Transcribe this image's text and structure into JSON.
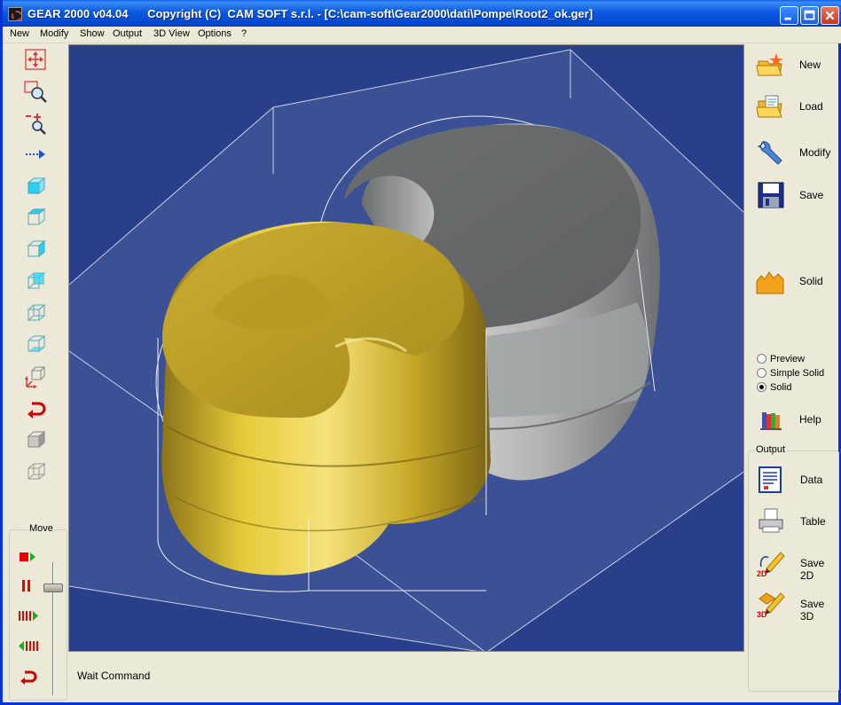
{
  "window": {
    "title": "GEAR 2000 v04.04      Copyright (C)  CAM SOFT s.r.l. - [C:\\cam-soft\\Gear2000\\dati\\Pompe\\Root2_ok.ger]"
  },
  "menu": [
    "New",
    "Modify",
    "Show",
    "Output",
    "3D View",
    "Options",
    "?"
  ],
  "left_tools": [
    "move-view-icon",
    "zoom-window-icon",
    "zoom-in-out-icon",
    "pan-arrow-icon",
    "view-front-cube-icon",
    "view-top-cube-icon",
    "view-side-cube-icon",
    "view-iso-cube-icon",
    "view-back-cube-icon",
    "view-bottom-cube-icon",
    "axes-cube-icon",
    "undo-red-arrow-icon",
    "solid-cube-icon",
    "wire-cube-icon"
  ],
  "move": {
    "label": "Move",
    "buttons": [
      "play-icon",
      "pause-icon",
      "fast-forward-icon",
      "rewind-icon",
      "reset-icon"
    ]
  },
  "status": {
    "text": "Wait Command"
  },
  "right": {
    "new": "New",
    "load": "Load",
    "modify": "Modify",
    "save": "Save",
    "solid": "Solid",
    "radio_options": [
      "Preview",
      "Simple Solid",
      "Solid"
    ],
    "radio_selected": "Solid",
    "help": "Help",
    "output_label": "Output",
    "data": "Data",
    "table": "Table",
    "save2d": "Save 2D",
    "save3d": "Save 3D"
  },
  "colors": {
    "viewport_bg": "#2a3f8a",
    "gold_rotor": "#d6b82e",
    "grey_rotor": "#a9abaa",
    "titlebar": "#0b5ae0"
  }
}
